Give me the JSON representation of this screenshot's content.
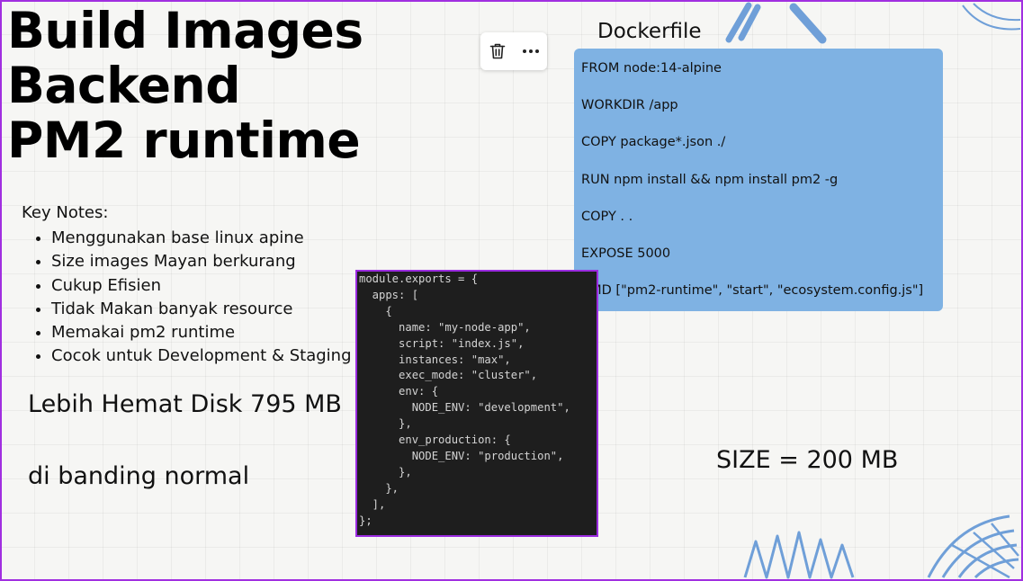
{
  "title": {
    "lines": [
      "Build Images",
      "Backend",
      "PM2 runtime"
    ]
  },
  "notes": {
    "heading": "Key Notes:",
    "items": [
      "Menggunakan base linux apine",
      "Size images Mayan berkurang",
      "Cukup Efisien",
      "Tidak Makan banyak resource",
      "Memakai pm2 runtime",
      "Cocok untuk Development & Staging"
    ]
  },
  "hemat_text": "Lebih Hemat Disk 795 MB",
  "banding_text": "di banding normal",
  "size_text": "SIZE = 200 MB",
  "toolbar": {
    "delete_icon": "trash-icon",
    "more_icon": "more-horizontal-icon"
  },
  "dockerfile": {
    "title": "Dockerfile",
    "lines": [
      "FROM node:14-alpine",
      "WORKDIR /app",
      "COPY package*.json ./",
      "RUN npm install && npm install pm2 -g",
      "COPY . .",
      "EXPOSE 5000",
      "CMD [\"pm2-runtime\", \"start\", \"ecosystem.config.js\"]"
    ]
  },
  "ecosystem_code": "module.exports = {\n  apps: [\n    {\n      name: \"my-node-app\",\n      script: \"index.js\",\n      instances: \"max\",\n      exec_mode: \"cluster\",\n      env: {\n        NODE_ENV: \"development\",\n      },\n      env_production: {\n        NODE_ENV: \"production\",\n      },\n    },\n  ],\n};",
  "colors": {
    "border_accent": "#a12fe0",
    "dockerfile_bg": "#7fb2e3",
    "code_bg": "#1e1e1e",
    "deco_blue": "#6f9fd8"
  }
}
